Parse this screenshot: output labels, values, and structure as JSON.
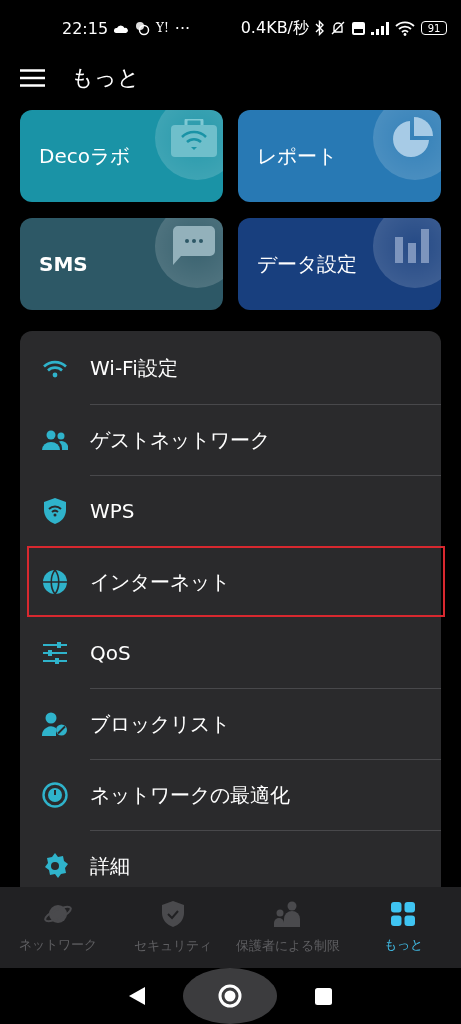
{
  "status_bar": {
    "time": "22:15",
    "carrier_mark": "Y!",
    "more": "···",
    "speed": "0.4KB/秒",
    "battery": "91"
  },
  "header": {
    "title": "もっと"
  },
  "tiles": [
    {
      "label": "Decoラボ",
      "color": "#1a93a6"
    },
    {
      "label": "レポート",
      "color": "#2879b4"
    },
    {
      "label": "SMS",
      "color": "#2d5866"
    },
    {
      "label": "データ設定",
      "color": "#183f7e"
    }
  ],
  "menu": [
    {
      "label": "Wi-Fi設定",
      "highlighted": false
    },
    {
      "label": "ゲストネットワーク",
      "highlighted": false
    },
    {
      "label": "WPS",
      "highlighted": false
    },
    {
      "label": "インターネット",
      "highlighted": true
    },
    {
      "label": "QoS",
      "highlighted": false
    },
    {
      "label": "ブロックリスト",
      "highlighted": false
    },
    {
      "label": "ネットワークの最適化",
      "highlighted": false
    },
    {
      "label": "詳細",
      "highlighted": false
    }
  ],
  "bottom_nav": [
    {
      "label": "ネットワーク",
      "selected": false
    },
    {
      "label": "セキュリティ",
      "selected": false
    },
    {
      "label": "保護者による制限",
      "selected": false
    },
    {
      "label": "もっと",
      "selected": true
    }
  ]
}
